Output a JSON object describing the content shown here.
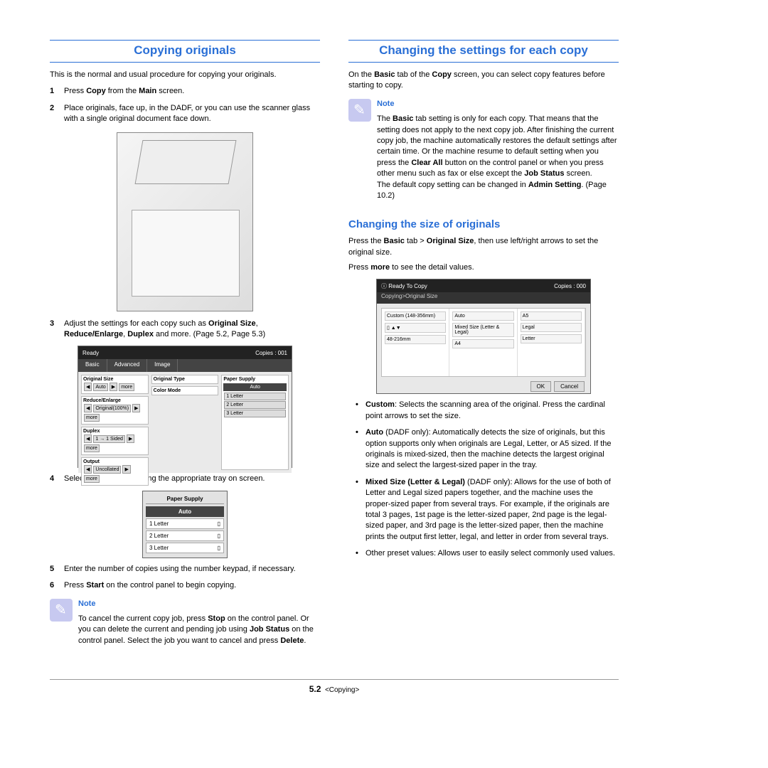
{
  "left": {
    "h1": "Copying originals",
    "intro": "This is the normal and usual procedure for copying your originals.",
    "steps": [
      {
        "n": "1",
        "html": "Press <b>Copy</b> from the <b>Main</b> screen."
      },
      {
        "n": "2",
        "html": "Place originals, face up, in the DADF, or you can use the scanner glass with a single original document face down."
      },
      {
        "n": "3",
        "html": "Adjust the settings for each copy such as <b>Original Size</b>, <b>Reduce/Enlarge</b>, <b>Duplex</b> and more. (Page 5.2, Page 5.3)"
      },
      {
        "n": "4",
        "html": "Select the tray by pressing the appropriate tray on screen."
      },
      {
        "n": "5",
        "html": "Enter the number of copies using the number keypad, if necessary."
      },
      {
        "n": "6",
        "html": "Press <b>Start</b> on the control panel to begin copying."
      }
    ],
    "screen1": {
      "status_left": "Ready",
      "status_right": "Copies : 001",
      "tabs": [
        "Basic",
        "Advanced",
        "Image"
      ],
      "left_labels": [
        "Original Size",
        "Reduce/Enlarge",
        "Duplex",
        "Output"
      ],
      "left_vals": [
        "Auto",
        "Original(100%)",
        "1 → 1 Sided",
        "Uncollated"
      ],
      "mid_label1": "Original Type",
      "mid_label2": "Color Mode",
      "right_label": "Paper Supply",
      "right_auto": "Auto",
      "right_rows": [
        "1  Letter",
        "2  Letter",
        "3  Letter"
      ]
    },
    "paper": {
      "hdr": "Paper Supply",
      "auto": "Auto",
      "rows": [
        "1  Letter",
        "2  Letter",
        "3  Letter"
      ]
    },
    "note_title": "Note",
    "note_html": "To cancel the current copy job, press <b>Stop</b> on the control panel. Or you can delete the current and pending job using <b>Job Status</b> on the control panel. Select the job you want to cancel and press <b>Delete</b>."
  },
  "right": {
    "h1": "Changing the settings for each copy",
    "intro_html": "On the <b>Basic</b> tab of the <b>Copy</b> screen, you can select copy features before starting to copy.",
    "note_title": "Note",
    "note_html": "The <b>Basic</b> tab setting is only for each copy. That means that the setting does not apply to the next copy job. After finishing the current copy job, the machine automatically restores the default settings after certain time. Or the machine resume to default setting when you press the <b>Clear All</b> button on the control panel or when you press other menu such as fax or else except the <b>Job Status</b> screen.<br>The default copy setting can be changed in <b>Admin Setting</b>. (Page 10.2)",
    "h2": "Changing the size of originals",
    "p1_html": "Press the <b>Basic</b> tab > <b>Original Size</b>, then use left/right arrows to set the original size.",
    "p2_html": "Press <b>more</b> to see the detail values.",
    "screen2": {
      "status_left": "Ready To Copy",
      "status_right": "Copies : 000",
      "crumb": "Copying>Original Size",
      "col1": [
        "Custom (148-356mm)",
        "48-216mm"
      ],
      "col2": [
        "Auto",
        "Mixed Size (Letter & Legal)",
        "A4"
      ],
      "col3": [
        "A5",
        "Legal",
        "Letter"
      ],
      "ok": "OK",
      "cancel": "Cancel"
    },
    "bullets": [
      "<b>Custom</b>: Selects the scanning area of the original. Press the cardinal point arrows to set the size.",
      "<b>Auto</b> (DADF only): Automatically detects the size of originals, but this option supports only when originals are Legal, Letter, or A5 sized. If the originals is mixed-sized, then the machine detects the largest original size and select the largest-sized paper in the tray.",
      "<b>Mixed Size (Letter & Legal)</b> (DADF only): Allows for the use of both of Letter and Legal sized papers together, and the machine uses the proper-sized paper from several trays. For example, if the originals are total 3 pages, 1st page is the letter-sized paper, 2nd page is the legal-sized paper, and 3rd page is the letter-sized paper, then the machine prints the output first letter, legal, and letter in order from several trays.",
      "Other preset values: Allows user to easily select commonly used values."
    ]
  },
  "footer": {
    "page": "5.2",
    "chapter": "<Copying>"
  }
}
